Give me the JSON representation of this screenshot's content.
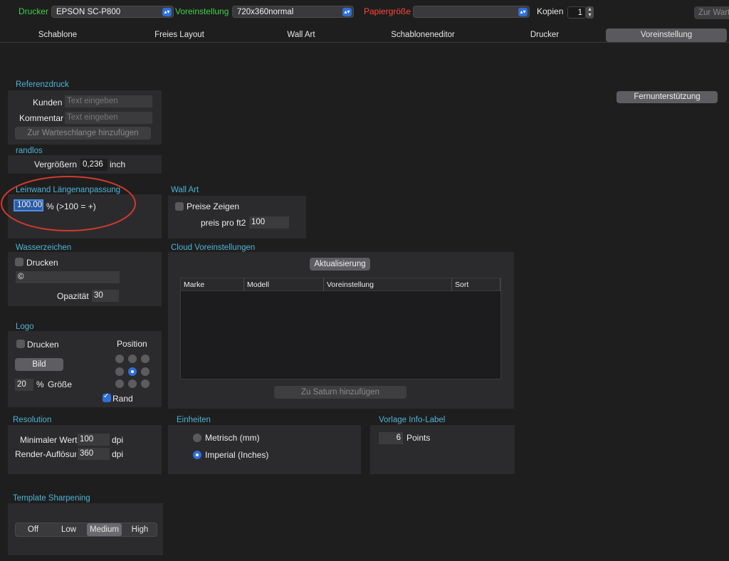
{
  "toolbar": {
    "printer_label": "Drucker",
    "printer_value": "EPSON SC-P800",
    "preset_label": "Voreinstellung",
    "preset_value": "720x360normal",
    "paper_label": "Papiergröße",
    "paper_value": "",
    "copies_label": "Kopien",
    "copies_value": "1",
    "queue_button": "Zur Warteschlange hinzufügen"
  },
  "tabs": [
    "Schablone",
    "Freies Layout",
    "Wall Art",
    "Schabloneneditor",
    "Drucker",
    "Voreinstellung"
  ],
  "selected_tab": "Voreinstellung",
  "remote_support_button": "Fernunterstützung",
  "referenzdruck": {
    "title": "Referenzdruck",
    "customer_label": "Kunden",
    "customer_placeholder": "Text eingeben",
    "comment_label": "Kommentar",
    "comment_placeholder": "Text eingeben",
    "queue_button": "Zur Warteschlange hinzufügen"
  },
  "randlos": {
    "title": "randlos",
    "enlarge_label": "Vergrößern",
    "enlarge_value": "0,236",
    "unit": "inch"
  },
  "leinwand": {
    "title": "Leinwand Längenanpassung",
    "value": "100.00",
    "suffix": "% (>100 = +)"
  },
  "wall_art": {
    "title": "Wall Art",
    "show_prices_label": "Preise Zeigen",
    "show_prices_checked": false,
    "price_label": "preis pro ft2",
    "price_value": "100"
  },
  "wasserzeichen": {
    "title": "Wasserzeichen",
    "print_label": "Drucken",
    "print_checked": false,
    "text_value": "©",
    "opacity_label": "Opazität",
    "opacity_value": "30"
  },
  "cloud": {
    "title": "Cloud Voreinstellungen",
    "refresh_button": "Aktualisierung",
    "columns": [
      "Marke",
      "Modell",
      "Voreinstellung",
      "Sort"
    ],
    "rows": [],
    "add_button": "Zu Saturn hinzufügen"
  },
  "logo": {
    "title": "Logo",
    "print_label": "Drucken",
    "print_checked": false,
    "image_button": "Bild",
    "size_value": "20",
    "size_unit": "%",
    "size_label": "Größe",
    "position_label": "Position",
    "position_selected": "middle-center",
    "border_label": "Rand",
    "border_checked": true
  },
  "resolution": {
    "title": "Resolution",
    "min_label": "Minimaler Wert",
    "min_value": "100",
    "min_unit": "dpi",
    "render_label": "Render-Auflösung",
    "render_value": "360",
    "render_unit": "dpi"
  },
  "einheiten": {
    "title": "Einheiten",
    "metric_label": "Metrisch (mm)",
    "imperial_label": "Imperial (Inches)",
    "selected": "imperial"
  },
  "vorlage": {
    "title": "Vorlage Info-Label",
    "value": "6",
    "unit": "Points"
  },
  "sharpening": {
    "title": "Template Sharpening",
    "options": [
      "Off",
      "Low",
      "Medium",
      "High"
    ],
    "selected": "Medium"
  },
  "colors": {
    "accent": "#2e6fd8",
    "section_title": "#4fb3d6",
    "annotation": "#d23a2e",
    "green_label": "#3fd14a",
    "red_label": "#ff453a"
  }
}
